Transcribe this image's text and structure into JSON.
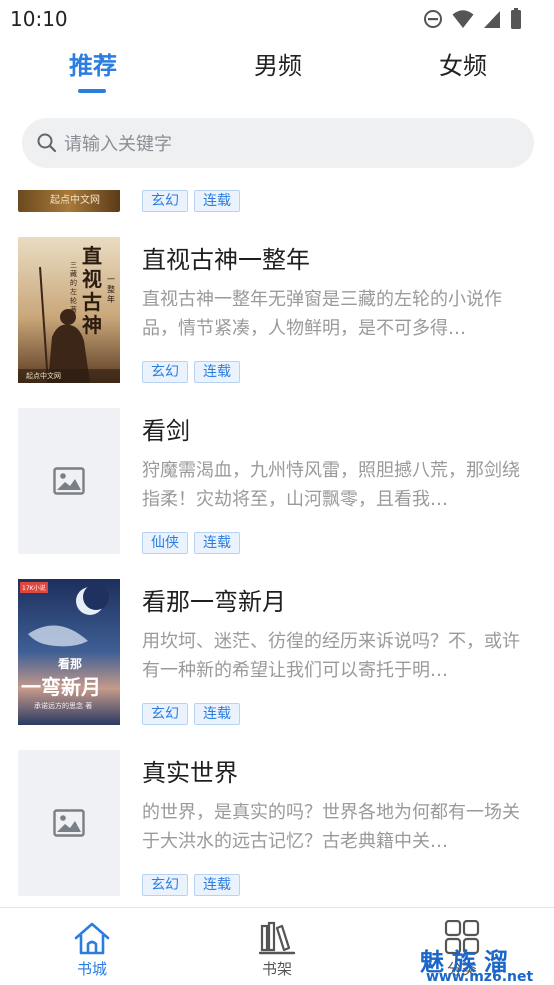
{
  "status_bar": {
    "time": "10:10"
  },
  "tabs": [
    {
      "label": "推荐",
      "active": true
    },
    {
      "label": "男频",
      "active": false
    },
    {
      "label": "女频",
      "active": false
    }
  ],
  "search": {
    "placeholder": "请输入关键字"
  },
  "partial_item": {
    "cover_text": "起点中文网",
    "tags": [
      "玄幻",
      "连载"
    ]
  },
  "books": [
    {
      "title": "直视古神一整年",
      "desc": "直视古神一整年无弹窗是三藏的左轮的小说作品，情节紧凑，人物鲜明，是不可多得…",
      "tags": [
        "玄幻",
        "连载"
      ],
      "cover": {
        "type": "image",
        "title_text": "直视古神",
        "side_text": "一整年",
        "author_text": "三藏的左轮 著",
        "publisher_text": "起点中文网"
      }
    },
    {
      "title": "看剑",
      "desc": "狩魔需渴血，九州恃风雷，照胆撼八荒，那剑绕指柔！灾劫将至，山河飘零，且看我…",
      "tags": [
        "仙侠",
        "连载"
      ],
      "cover": {
        "type": "placeholder"
      }
    },
    {
      "title": "看那一弯新月",
      "desc": "用坎坷、迷茫、彷徨的经历来诉说吗？不，或许有一种新的希望让我们可以寄托于明…",
      "tags": [
        "玄幻",
        "连载"
      ],
      "cover": {
        "type": "image",
        "badge_text": "17K小说",
        "title_small": "看那",
        "title_big": "一弯新月",
        "author_text": "承诺远方的思念 著"
      }
    },
    {
      "title": "真实世界",
      "desc": "的世界，是真实的吗？世界各地为何都有一场关于大洪水的远古记忆？古老典籍中关…",
      "tags": [
        "玄幻",
        "连载"
      ],
      "cover": {
        "type": "placeholder"
      }
    }
  ],
  "bottom_nav": [
    {
      "label": "书城",
      "icon": "home-icon",
      "active": true
    },
    {
      "label": "书架",
      "icon": "bookshelf-icon",
      "active": false
    },
    {
      "label": "分类",
      "icon": "grid-icon",
      "active": false
    }
  ],
  "watermark": {
    "big": "魅族溜",
    "small": "www.mz6.net"
  },
  "colors": {
    "accent": "#2b7de0",
    "tag_bg": "#eaf3fd",
    "search_bg": "#eef0f2"
  }
}
